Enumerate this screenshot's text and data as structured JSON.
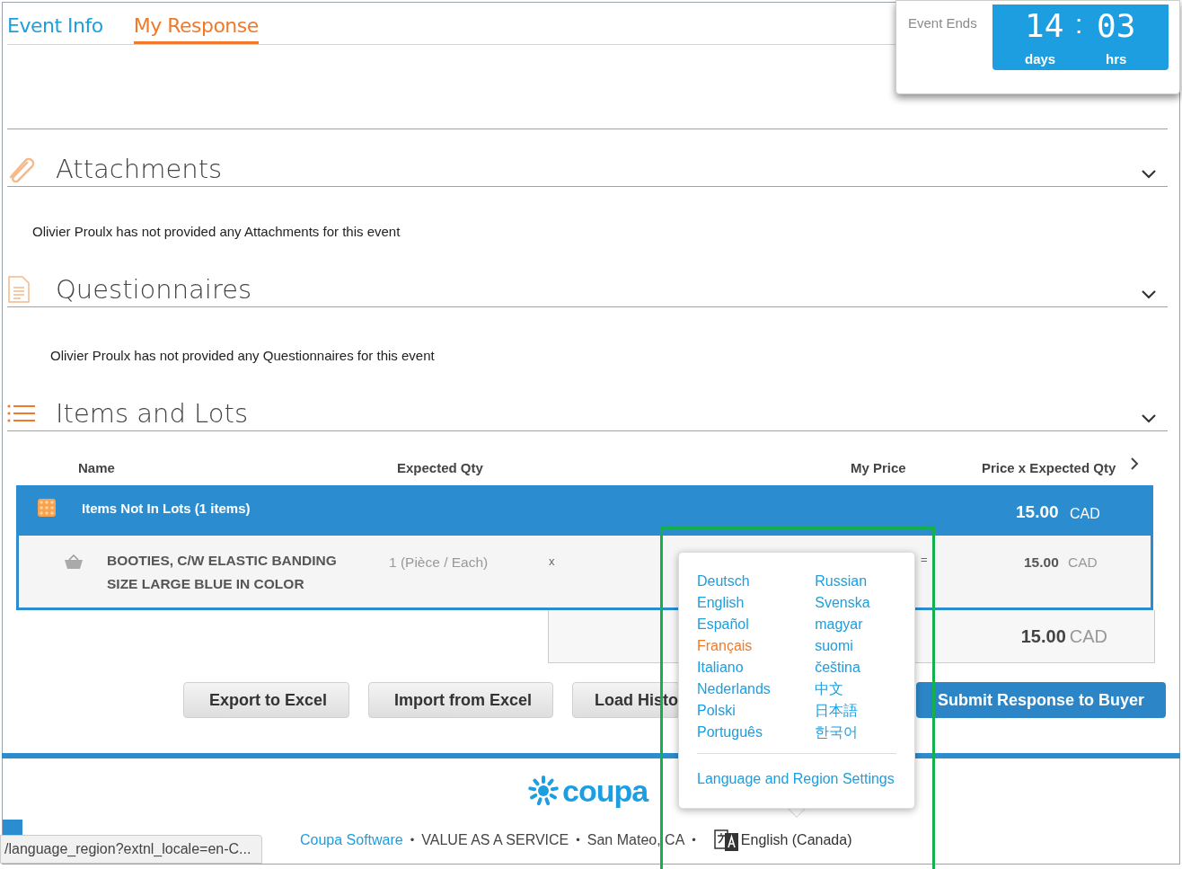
{
  "tabs": [
    {
      "label": "Event Info",
      "selected": false
    },
    {
      "label": "My Response",
      "selected": true
    }
  ],
  "timer": {
    "label": "Event Ends",
    "days": "14",
    "separator": ":",
    "hours": "03",
    "days_unit": "days",
    "hours_unit": "hrs"
  },
  "sections": [
    {
      "kind": "attachments",
      "title": "Attachments",
      "message": "Olivier Proulx has not provided any Attachments for this event"
    },
    {
      "kind": "questionnaires",
      "title": "Questionnaires",
      "message": "Olivier Proulx has not provided any Questionnaires for this event"
    },
    {
      "kind": "items",
      "title": "Items and Lots"
    }
  ],
  "items_table": {
    "columns": [
      "Name",
      "Expected Qty",
      "My Price",
      "Price x Expected Qty"
    ],
    "group": {
      "title": "Items Not In Lots (1 items)",
      "total": "15.00",
      "currency": "CAD"
    },
    "rows": [
      {
        "name": "BOOTIES, C/W ELASTIC BANDING SIZE LARGE BLUE IN COLOR",
        "qty": "1 (Pièce / Each)",
        "times": "x",
        "equals": "=",
        "total": "15.00",
        "currency": "CAD"
      }
    ],
    "grand_total": {
      "amount": "15.00",
      "currency": "CAD"
    }
  },
  "buttons": [
    {
      "label": "Export to Excel",
      "kind": "secondary"
    },
    {
      "label": "Import from Excel",
      "kind": "secondary"
    },
    {
      "label": "Load Histo",
      "kind": "secondary"
    },
    {
      "label": "Submit Response to Buyer",
      "kind": "primary"
    }
  ],
  "language_menu": {
    "languages": [
      {
        "label": "Deutsch",
        "selected": false
      },
      {
        "label": "English",
        "selected": false
      },
      {
        "label": "Español",
        "selected": false
      },
      {
        "label": "Français",
        "selected": true
      },
      {
        "label": "Italiano",
        "selected": false
      },
      {
        "label": "Nederlands",
        "selected": false
      },
      {
        "label": "Polski",
        "selected": false
      },
      {
        "label": "Português",
        "selected": false
      },
      {
        "label": "Russian",
        "selected": false
      },
      {
        "label": "Svenska",
        "selected": false
      },
      {
        "label": "magyar",
        "selected": false
      },
      {
        "label": "suomi",
        "selected": false
      },
      {
        "label": "čeština",
        "selected": false
      },
      {
        "label": "中文",
        "selected": false
      },
      {
        "label": "日本語",
        "selected": false
      },
      {
        "label": "한국어",
        "selected": false
      }
    ],
    "settings_link": "Language and Region Settings"
  },
  "footer": {
    "logo": "coupa",
    "company": "Coupa Software",
    "separator": "•",
    "tagline": "VALUE AS A SERVICE",
    "location": "San Mateo, CA",
    "language": "English (Canada)"
  },
  "status_url": "/language_region?extnl_locale=en-C..."
}
